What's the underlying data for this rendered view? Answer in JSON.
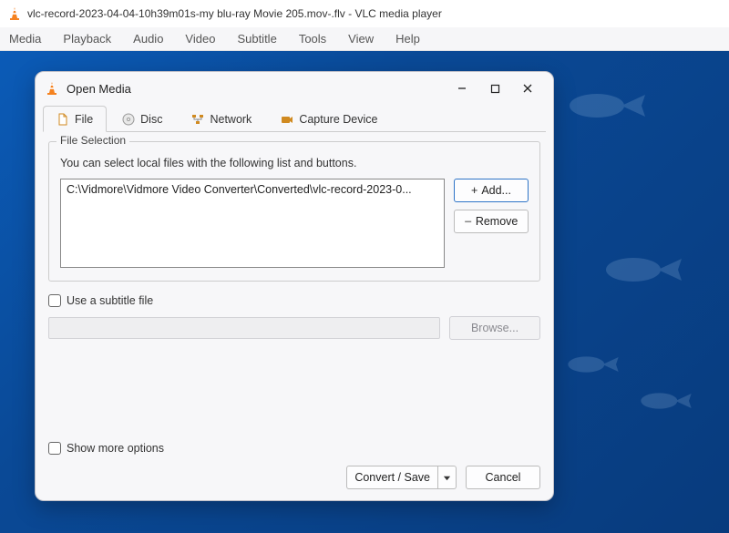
{
  "app": {
    "title": "vlc-record-2023-04-04-10h39m01s-my blu-ray Movie 205.mov-.flv - VLC media player",
    "menu": [
      "Media",
      "Playback",
      "Audio",
      "Video",
      "Subtitle",
      "Tools",
      "View",
      "Help"
    ]
  },
  "dialog": {
    "title": "Open Media",
    "tabs": {
      "file": "File",
      "disc": "Disc",
      "network": "Network",
      "capture": "Capture Device"
    },
    "file_section": {
      "legend": "File Selection",
      "hint": "You can select local files with the following list and buttons.",
      "entry": "C:\\Vidmore\\Vidmore Video Converter\\Converted\\vlc-record-2023-0...",
      "add": "Add...",
      "remove": "Remove"
    },
    "subtitle": {
      "checkbox": "Use a subtitle file",
      "browse": "Browse..."
    },
    "show_more": "Show more options",
    "actions": {
      "convert": "Convert / Save",
      "cancel": "Cancel"
    }
  }
}
